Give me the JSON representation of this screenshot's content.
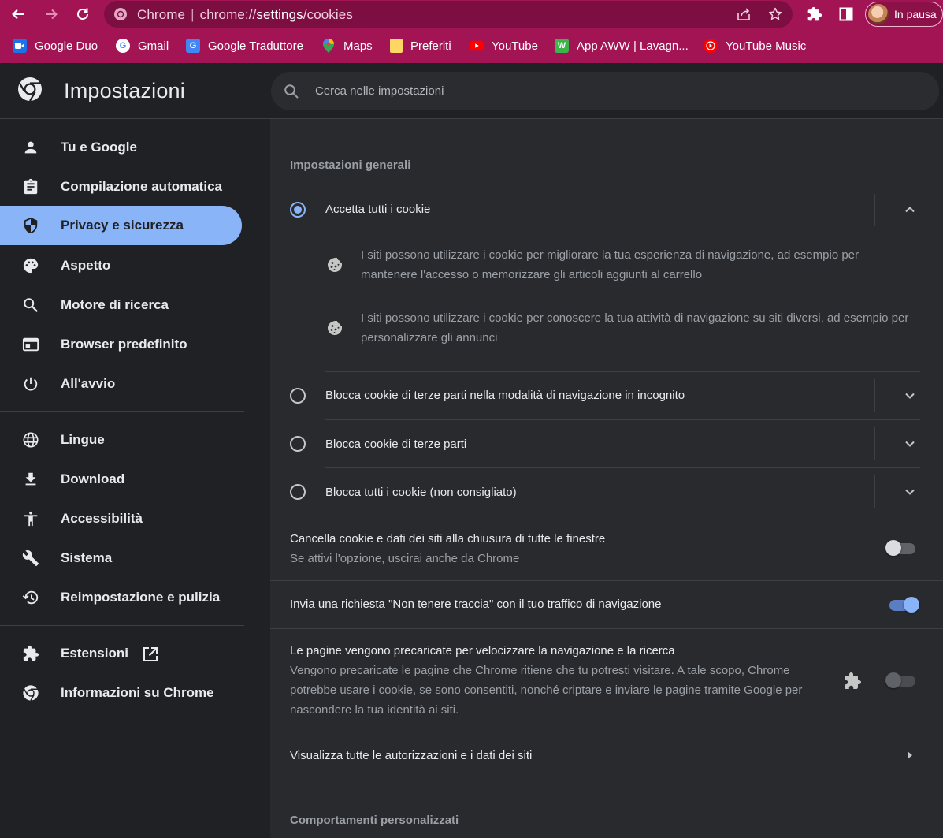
{
  "browser": {
    "url_prefix": "Chrome",
    "url_scheme": "chrome://",
    "url_host": "settings",
    "url_path": "/cookies",
    "profile_label": "In pausa",
    "theme_color": "#a31455"
  },
  "bookmarks": [
    {
      "label": "Google Duo",
      "icon": "google-duo-icon",
      "color": "#1a73e8"
    },
    {
      "label": "Gmail",
      "icon": "google-g-icon",
      "color": "#ffffff"
    },
    {
      "label": "Google Traduttore",
      "icon": "google-translate-icon",
      "color": "#4285f4"
    },
    {
      "label": "Maps",
      "icon": "maps-pin-icon",
      "color": "#34a853"
    },
    {
      "label": "Preferiti",
      "icon": "folder-icon",
      "color": "#fdd663"
    },
    {
      "label": "YouTube",
      "icon": "youtube-icon",
      "color": "#ff0000"
    },
    {
      "label": "App AWW | Lavagn...",
      "icon": "aww-app-icon",
      "color": "#3bb54a"
    },
    {
      "label": "YouTube Music",
      "icon": "youtube-music-icon",
      "color": "#ff0000"
    }
  ],
  "header": {
    "title": "Impostazioni",
    "search_placeholder": "Cerca nelle impostazioni"
  },
  "sidebar": {
    "items": [
      {
        "label": "Tu e Google",
        "icon": "person-icon"
      },
      {
        "label": "Compilazione automatica",
        "icon": "clipboard-icon"
      },
      {
        "label": "Privacy e sicurezza",
        "icon": "shield-icon",
        "active": true
      },
      {
        "label": "Aspetto",
        "icon": "palette-icon"
      },
      {
        "label": "Motore di ricerca",
        "icon": "search-icon"
      },
      {
        "label": "Browser predefinito",
        "icon": "browser-window-icon"
      },
      {
        "label": "All'avvio",
        "icon": "power-icon"
      },
      {
        "label": "Lingue",
        "icon": "globe-icon"
      },
      {
        "label": "Download",
        "icon": "download-icon"
      },
      {
        "label": "Accessibilità",
        "icon": "accessibility-icon"
      },
      {
        "label": "Sistema",
        "icon": "wrench-icon"
      },
      {
        "label": "Reimpostazione e pulizia",
        "icon": "restore-icon"
      },
      {
        "label": "Estensioni",
        "icon": "puzzle-icon",
        "trailing_icon": "open-in-new-icon"
      },
      {
        "label": "Informazioni su Chrome",
        "icon": "chrome-icon"
      }
    ],
    "accent_color": "#8ab4f8"
  },
  "main": {
    "general_title": "Impostazioni generali",
    "options": [
      {
        "label": "Accetta tutti i cookie",
        "selected": true,
        "expanded": true
      },
      {
        "label": "Blocca cookie di terze parti nella modalità di navigazione in incognito",
        "selected": false,
        "expanded": false
      },
      {
        "label": "Blocca cookie di terze parti",
        "selected": false,
        "expanded": false
      },
      {
        "label": "Blocca tutti i cookie (non consigliato)",
        "selected": false,
        "expanded": false
      }
    ],
    "accept_details": [
      "I siti possono utilizzare i cookie per migliorare la tua esperienza di navigazione, ad esempio per mantenere l'accesso o memorizzare gli articoli aggiunti al carrello",
      "I siti possono utilizzare i cookie per conoscere la tua attività di navigazione su siti diversi, ad esempio per personalizzare gli annunci"
    ],
    "clear_on_exit": {
      "title": "Cancella cookie e dati dei siti alla chiusura di tutte le finestre",
      "subtitle": "Se attivi l'opzione, uscirai anche da Chrome",
      "enabled": false
    },
    "do_not_track": {
      "title": "Invia una richiesta \"Non tenere traccia\" con il tuo traffico di navigazione",
      "enabled": true
    },
    "preload": {
      "title": "Le pagine vengono precaricate per velocizzare la navigazione e la ricerca",
      "subtitle": "Vengono precaricate le pagine che Chrome ritiene che tu potresti visitare. A tale scopo, Chrome potrebbe usare i cookie, se sono consentiti, nonché criptare e inviare le pagine tramite Google per nascondere la tua identità ai siti.",
      "enabled": false,
      "managed_by_extension": true
    },
    "all_permissions": "Visualizza tutte le autorizzazioni e i dati dei siti",
    "custom_title": "Comportamenti personalizzati"
  }
}
